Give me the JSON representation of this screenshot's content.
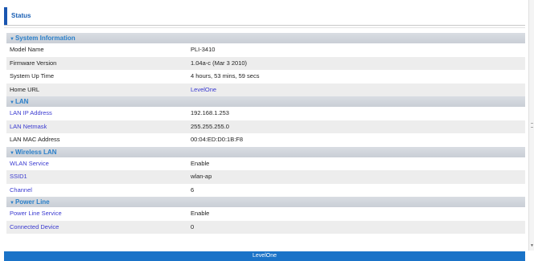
{
  "page": {
    "title": "Status"
  },
  "sections": {
    "system": {
      "heading": "System Information",
      "model_label": "Model Name",
      "model_value": "PLI-3410",
      "firmware_label": "Firmware Version",
      "firmware_value": "1.04a-c (Mar 3 2010)",
      "uptime_label": "System Up Time",
      "uptime_value": "4 hours, 53 mins, 59 secs",
      "home_label": "Home URL",
      "home_value": "LevelOne"
    },
    "lan": {
      "heading": "LAN",
      "ip_label": "LAN IP Address",
      "ip_value": "192.168.1.253",
      "mask_label": "LAN Netmask",
      "mask_value": "255.255.255.0",
      "mac_label": "LAN MAC Address",
      "mac_value": "00:04:ED:D0:1B:F8"
    },
    "wireless": {
      "heading": "Wireless LAN",
      "service_label": "WLAN Service",
      "service_value": "Enable",
      "ssid_label": "SSID1",
      "ssid_value": "wlan-ap",
      "channel_label": "Channel",
      "channel_value": "6"
    },
    "powerline": {
      "heading": "Power Line",
      "service_label": "Power Line Service",
      "service_value": "Enable",
      "device_label": "Connected Device",
      "device_value": "0"
    }
  },
  "footer": {
    "text": "LevelOne"
  },
  "colors": {
    "accent": "#1a56b0",
    "footer_bg": "#1a73c8",
    "section_text": "#2a7fc9",
    "link": "#3a3ad0"
  }
}
